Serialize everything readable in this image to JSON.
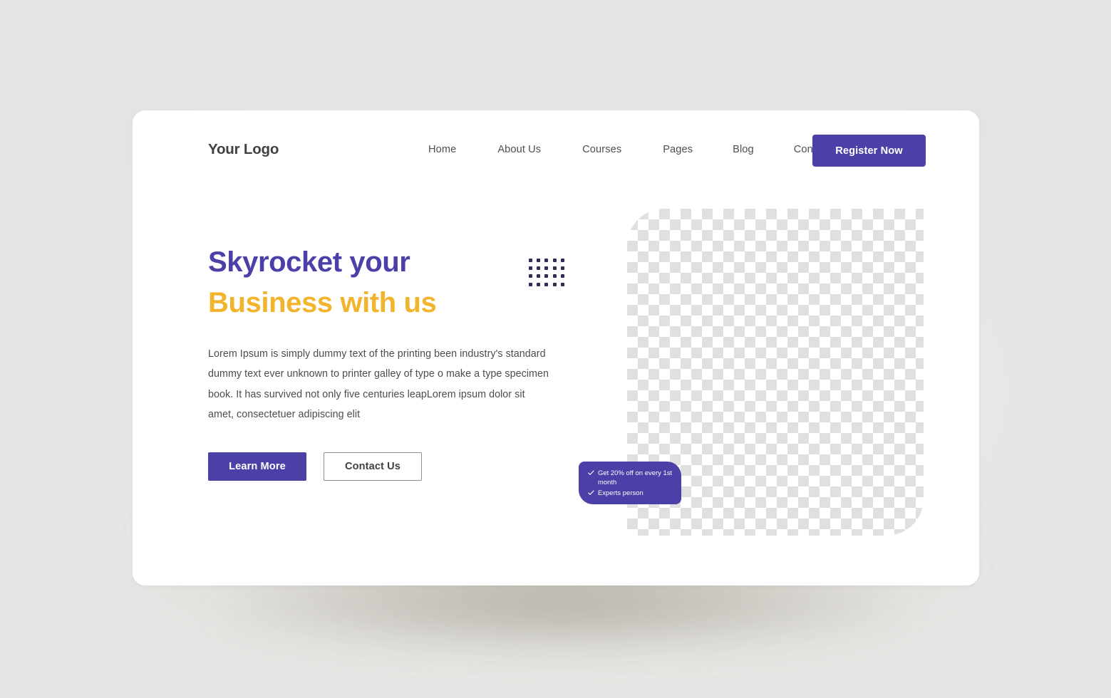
{
  "navbar": {
    "logo": "Your Logo",
    "links": [
      {
        "label": "Home"
      },
      {
        "label": "About Us"
      },
      {
        "label": "Courses"
      },
      {
        "label": "Pages"
      },
      {
        "label": "Blog"
      },
      {
        "label": "Contact"
      }
    ],
    "cta": {
      "label": "Register Now"
    }
  },
  "hero": {
    "title_line1": "Skyrocket your",
    "title_line2": "Business with us",
    "paragraph": "Lorem Ipsum is simply dummy text of the printing  been industry's standard dummy text ever unknown to printer galley of type o make a type specimen book. It has survived not only five centuries leapLorem ipsum dolor sit amet, consectetuer adipiscing elit",
    "primary_button": "Learn More",
    "secondary_button": "Contact Us",
    "decoration": {
      "dot_grid_columns": 5,
      "dot_grid_rows": 4
    }
  },
  "offer_badge": {
    "items": [
      {
        "text": "Get 20% off on every 1st month",
        "icon": "check-icon"
      },
      {
        "text": "Experts person",
        "icon": "check-icon"
      }
    ]
  },
  "colors": {
    "page_background": "#e9e9e9",
    "card_background": "#ffffff",
    "brand_purple": "#4b3fa8",
    "accent_yellow": "#f2b42c",
    "body_text": "#4c4c50",
    "logo_text": "#414042",
    "checker_light": "#ffffff",
    "checker_dark": "#e0e0e0"
  }
}
